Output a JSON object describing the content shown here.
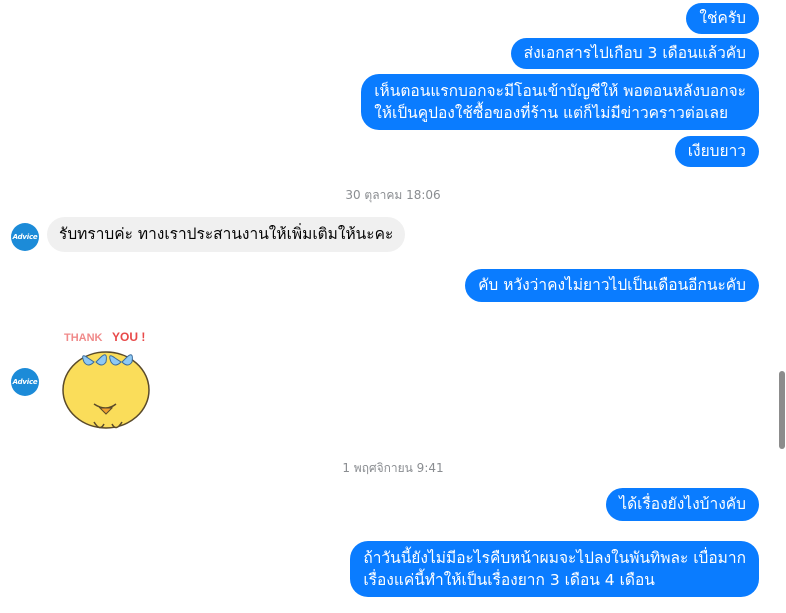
{
  "avatar_label": "Advice",
  "messages_block1": {
    "m1": "ใช่ครับ",
    "m2": "ส่งเอกสารไปเกือบ 3 เดือนแล้วคับ",
    "m3_line1": "เห็นตอนแรกบอกจะมีโอนเข้าบัญชีให้ พอตอนหลังบอกจะ",
    "m3_line2": "ให้เป็นคูปองใช้ซื้อของที่ร้าน แต่ก็ไม่มีข่าวคราวต่อเลย",
    "m4": "เงียบยาว"
  },
  "timestamp1": "30 ตุลาคม 18:06",
  "reply_in1": "รับทราบค่ะ ทางเราประสานงานให้เพิ่มเติมให้นะคะ",
  "out5": "คับ หวังว่าคงไม่ยาวไปเป็นเดือนอีกนะคับ",
  "sticker": {
    "text_thank": "THANK",
    "text_you": "YOU !"
  },
  "timestamp2": "1 พฤศจิกายน 9:41",
  "out6": "ได้เรื่องยังไงบ้างคับ",
  "out7_line1": "ถ้าวันนี้ยังไม่มีอะไรคืบหน้าผมจะไปลงในพันทิพละ เบื่อมาก",
  "out7_line2": "เรื่องแค่นี้ทำให้เป็นเรื่องยาก 3 เดือน 4 เดือน",
  "colors": {
    "outgoing": "#0a7cff",
    "incoming": "#f0f0f0",
    "timestamp": "#8a8d91"
  }
}
